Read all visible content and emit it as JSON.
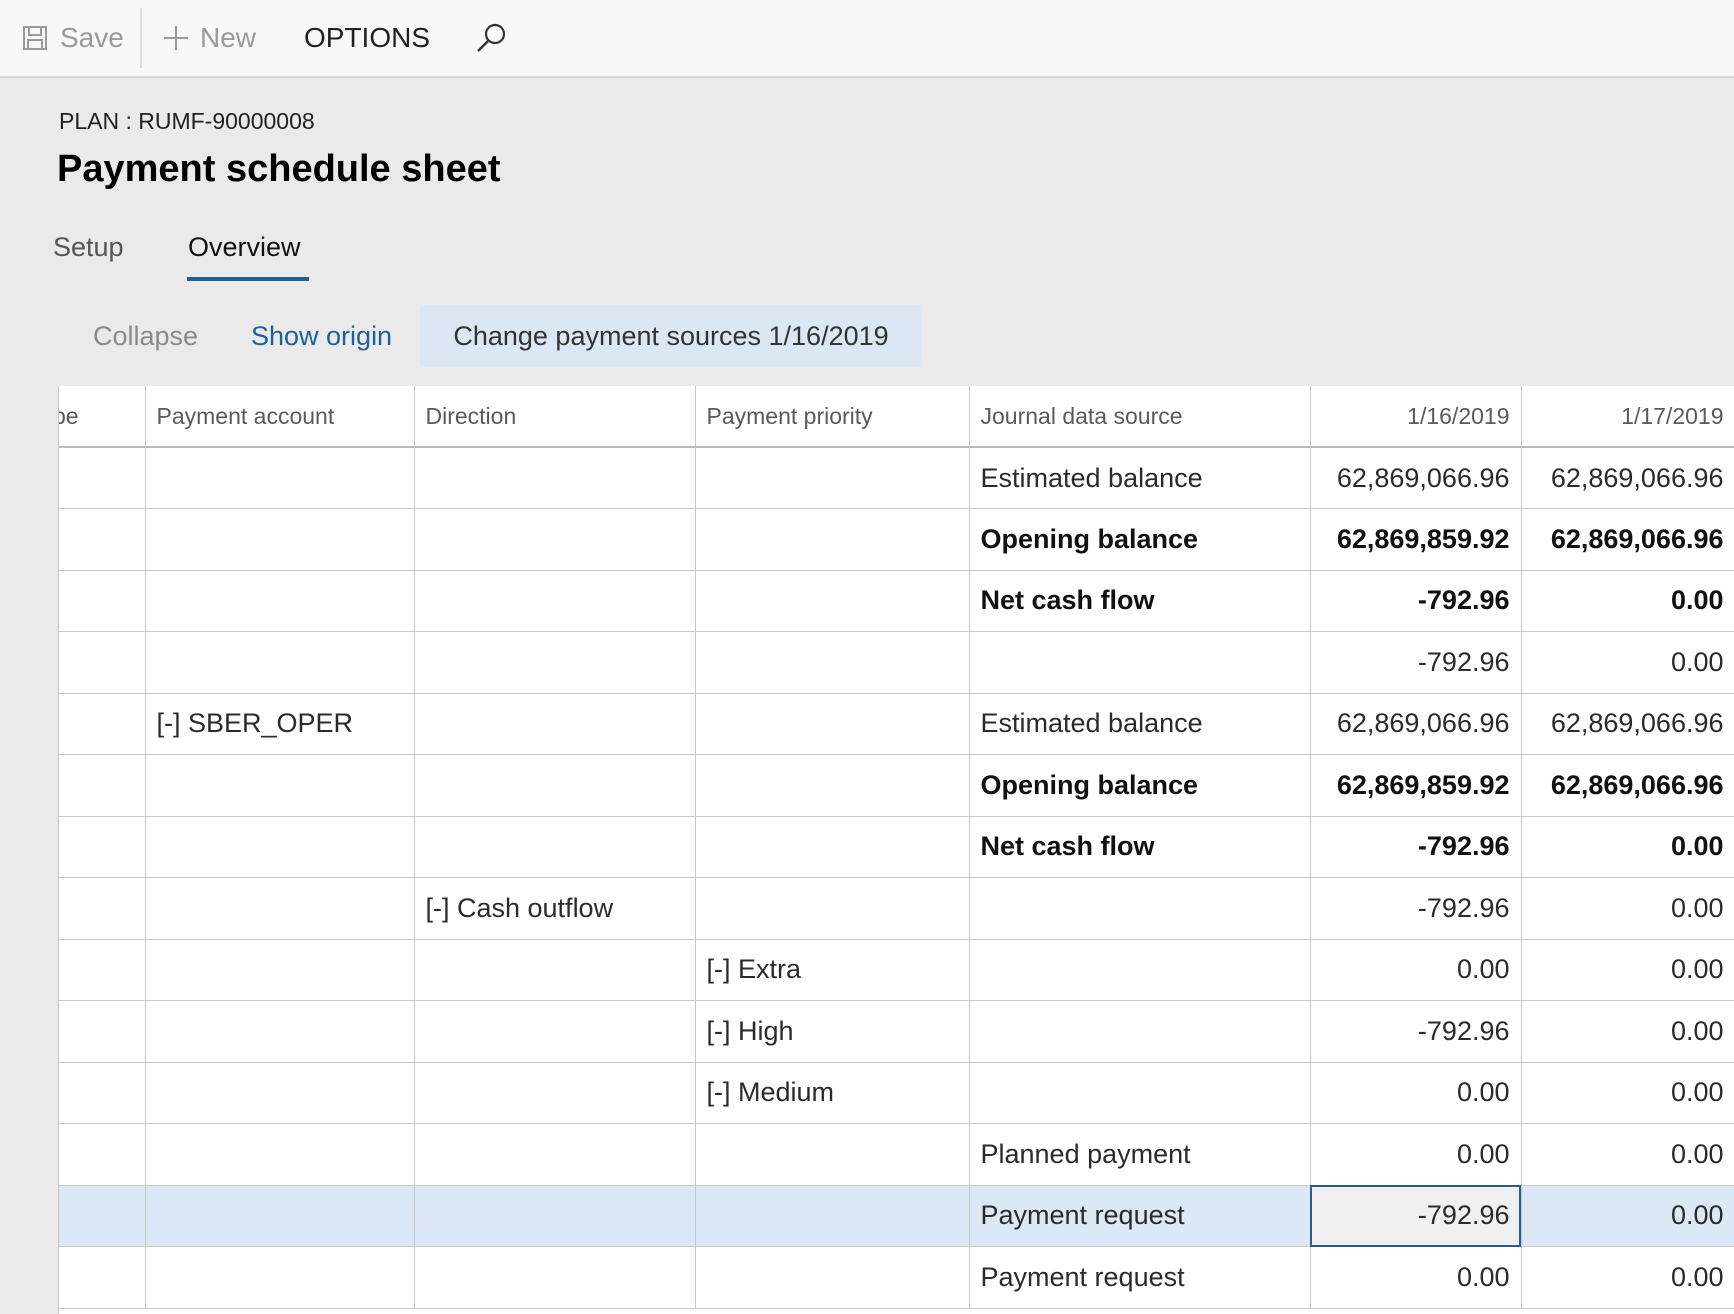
{
  "toolbar": {
    "save_label": "Save",
    "new_label": "New",
    "options_label": "OPTIONS",
    "icons": {
      "save": "save-icon",
      "new": "plus-icon",
      "search": "search-icon"
    }
  },
  "header": {
    "plan_label": "PLAN : RUMF-90000008",
    "title": "Payment schedule sheet"
  },
  "tabs": [
    {
      "label": "Setup",
      "active": false
    },
    {
      "label": "Overview",
      "active": true
    }
  ],
  "actions": {
    "collapse": "Collapse",
    "show_origin": "Show origin",
    "change_sources": "Change payment sources 1/16/2019"
  },
  "colors": {
    "accent": "#1f5f9a",
    "selected_row": "#dce8f5",
    "action_highlight": "#dbe7f4",
    "background": "#eaeaea"
  },
  "grid": {
    "columns": [
      "pe",
      "Payment account",
      "Direction",
      "Payment priority",
      "Journal data source",
      "1/16/2019",
      "1/17/2019"
    ],
    "rows": [
      {
        "first": "",
        "account": "",
        "direction": "",
        "priority": "",
        "source": "Estimated balance",
        "d1": "62,869,066.96",
        "d2": "62,869,066.96",
        "bold": false
      },
      {
        "first": "",
        "account": "",
        "direction": "",
        "priority": "",
        "source": "Opening balance",
        "d1": "62,869,859.92",
        "d2": "62,869,066.96",
        "bold": true
      },
      {
        "first": "",
        "account": "",
        "direction": "",
        "priority": "",
        "source": "Net cash flow",
        "d1": "-792.96",
        "d2": "0.00",
        "bold": true
      },
      {
        "first": "",
        "account": "",
        "direction": "",
        "priority": "",
        "source": "",
        "d1": "-792.96",
        "d2": "0.00",
        "bold": false
      },
      {
        "first": "",
        "account": "[-] SBER_OPER",
        "direction": "",
        "priority": "",
        "source": "Estimated balance",
        "d1": "62,869,066.96",
        "d2": "62,869,066.96",
        "bold": false
      },
      {
        "first": "",
        "account": "",
        "direction": "",
        "priority": "",
        "source": "Opening balance",
        "d1": "62,869,859.92",
        "d2": "62,869,066.96",
        "bold": true
      },
      {
        "first": "",
        "account": "",
        "direction": "",
        "priority": "",
        "source": "Net cash flow",
        "d1": "-792.96",
        "d2": "0.00",
        "bold": true
      },
      {
        "first": "",
        "account": "",
        "direction": "[-] Cash outflow",
        "priority": "",
        "source": "",
        "d1": "-792.96",
        "d2": "0.00",
        "bold": false
      },
      {
        "first": "",
        "account": "",
        "direction": "",
        "priority": "[-] Extra",
        "source": "",
        "d1": "0.00",
        "d2": "0.00",
        "bold": false
      },
      {
        "first": "",
        "account": "",
        "direction": "",
        "priority": "[-] High",
        "source": "",
        "d1": "-792.96",
        "d2": "0.00",
        "bold": false
      },
      {
        "first": "",
        "account": "",
        "direction": "",
        "priority": "[-] Medium",
        "source": "",
        "d1": "0.00",
        "d2": "0.00",
        "bold": false
      },
      {
        "first": "",
        "account": "",
        "direction": "",
        "priority": "",
        "source": "Planned payment",
        "d1": "0.00",
        "d2": "0.00",
        "bold": false
      },
      {
        "first": "",
        "account": "",
        "direction": "",
        "priority": "",
        "source": "Payment request",
        "d1": "-792.96",
        "d2": "0.00",
        "bold": false,
        "selected": true
      },
      {
        "first": "",
        "account": "",
        "direction": "",
        "priority": "",
        "source": "Payment request",
        "d1": "0.00",
        "d2": "0.00",
        "bold": false
      }
    ]
  }
}
